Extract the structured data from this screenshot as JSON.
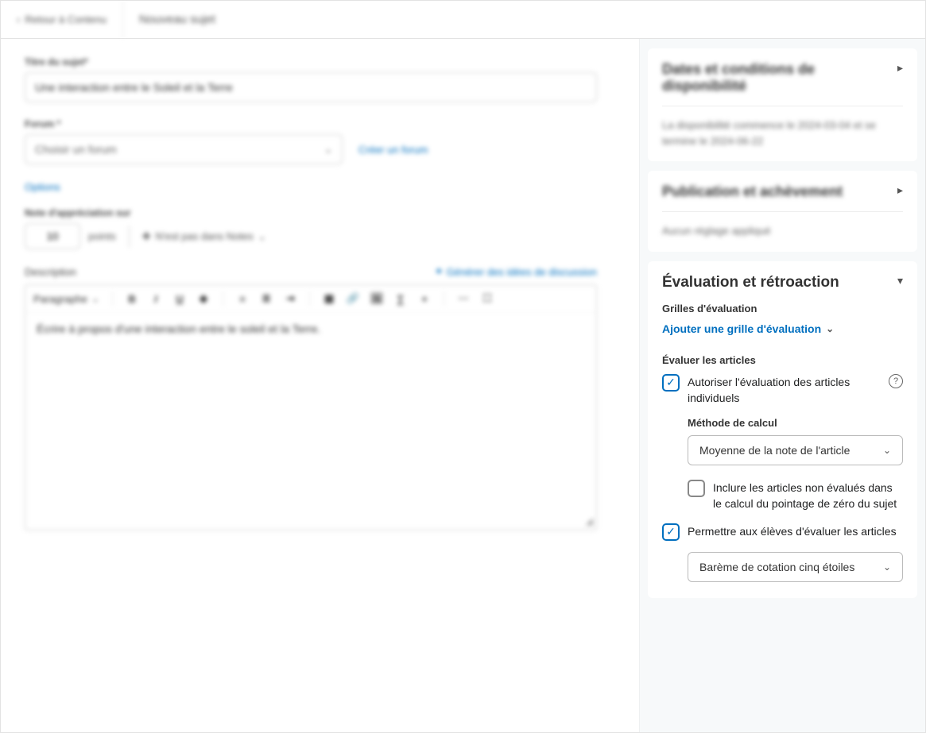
{
  "header": {
    "back_label": "Retour à Contenu",
    "title": "Nouveau sujet"
  },
  "main": {
    "title_label": "Titre du sujet*",
    "title_value": "Une interaction entre le Soleil et la Terre",
    "forum_label": "Forum *",
    "forum_placeholder": "Choisir un forum",
    "create_forum_link": "Créer un forum",
    "options_link": "Options",
    "grade_label": "Note d'appréciation sur",
    "grade_value": "10",
    "grade_points": "points",
    "not_in_notes_label": "N'est pas dans Notes",
    "description_label": "Description",
    "generate_link": "Générer des idées de discussion",
    "editor": {
      "paragraph": "Paragraphe",
      "content": "Écrire à propos d'une interaction entre le soleil et la Terre."
    }
  },
  "sidebar": {
    "panel1": {
      "title": "Dates et conditions de disponibilité",
      "desc": "La disponibilité commence le 2024-03-04 et se termine le 2024-06-22"
    },
    "panel2": {
      "title": "Publication et achèvement",
      "desc": "Aucun réglage appliqué"
    },
    "eval": {
      "title": "Évaluation et rétroaction",
      "grids_label": "Grilles d'évaluation",
      "add_grid": "Ajouter une grille d'évaluation",
      "evaluate_label": "Évaluer les articles",
      "allow_individual": "Autoriser l'évaluation des articles individuels",
      "calc_method_label": "Méthode de calcul",
      "calc_method_value": "Moyenne de la note de l'article",
      "include_unrated": "Inclure les articles non évalués dans le calcul du pointage de zéro du sujet",
      "allow_students": "Permettre aux élèves d'évaluer les articles",
      "rating_scheme": "Barème de cotation cinq étoiles"
    }
  }
}
